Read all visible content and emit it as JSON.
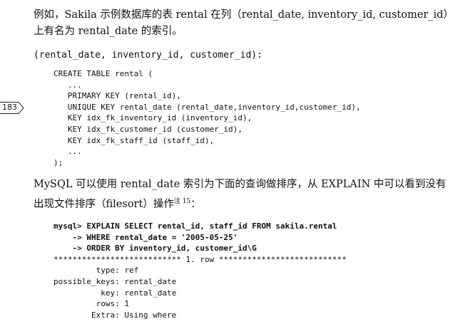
{
  "para1": {
    "line1": "例如，Sakila 示例数据库的表 rental 在列（rental_date, inventory_id, customer_id）",
    "line2": "上有名为 rental_date 的索引。"
  },
  "code_head": "(rental_date, inventory_id, customer_id):",
  "code_block1": "CREATE TABLE rental (\n   ...\n   PRIMARY KEY (rental_id),\n   UNIQUE KEY rental_date (rental_date,inventory_id,customer_id),\n   KEY idx_fk_inventory_id (inventory_id),\n   KEY idx_fk_customer_id (customer_id),\n   KEY idx_fk_staff_id (staff_id),\n   ...\n);",
  "page_marker": "183",
  "para2": {
    "line1": "MySQL 可以使用 rental_date 索引为下面的查询做排序，从 EXPLAIN 中可以看到没有",
    "line2": "出现文件排序（filesort）操作",
    "note": "注 15",
    "line2_end": "："
  },
  "code_block2": {
    "query1": "mysql> EXPLAIN SELECT rental_id, staff_id FROM sakila.rental",
    "query2": "    -> WHERE rental_date = '2005-05-25'",
    "query3": "    -> ORDER BY inventory_id, customer_id\\G",
    "result": "*************************** 1. row ***************************\n         type: ref\npossible_keys: rental_date\n          key: rental_date\n         rows: 1\n        Extra: Using where"
  }
}
